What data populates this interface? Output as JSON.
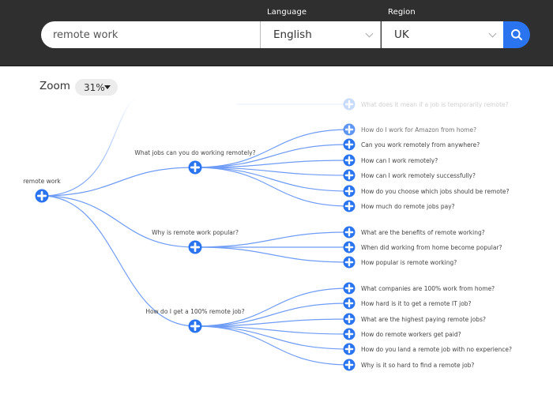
{
  "header": {
    "search": {
      "value": "remote work",
      "placeholder": ""
    },
    "language": {
      "label": "Language",
      "value": "English"
    },
    "region": {
      "label": "Region",
      "value": "UK"
    },
    "search_button_icon": "search-icon"
  },
  "zoom": {
    "label": "Zoom",
    "value": "31%"
  },
  "colors": {
    "accent": "#2b74f0",
    "link_line": "#6f9cf5",
    "topbar": "#2f2f2f"
  },
  "tree": {
    "root": {
      "label": "remote work"
    },
    "faded_leaf": {
      "label": "What does it mean if a job is temporarily remote?"
    },
    "branches": [
      {
        "label": "What jobs can you do working remotely?",
        "children": [
          "How do I work for Amazon from home?",
          "Can you work remotely from anywhere?",
          "How can I work remotely?",
          "How can I work remotely successfully?",
          "How do you choose which jobs should be remote?",
          "How much do remote jobs pay?"
        ]
      },
      {
        "label": "Why is remote work popular?",
        "children": [
          "What are the benefits of remote working?",
          "When did working from home become popular?",
          "How popular is remote working?"
        ]
      },
      {
        "label": "How do I get a 100% remote job?",
        "children": [
          "What companies are 100% work from home?",
          "How hard is it to get a remote IT job?",
          "What are the highest paying remote jobs?",
          "How do remote workers get paid?",
          "How do you land a remote job with no experience?",
          "Why is it so hard to find a remote job?"
        ]
      }
    ]
  }
}
